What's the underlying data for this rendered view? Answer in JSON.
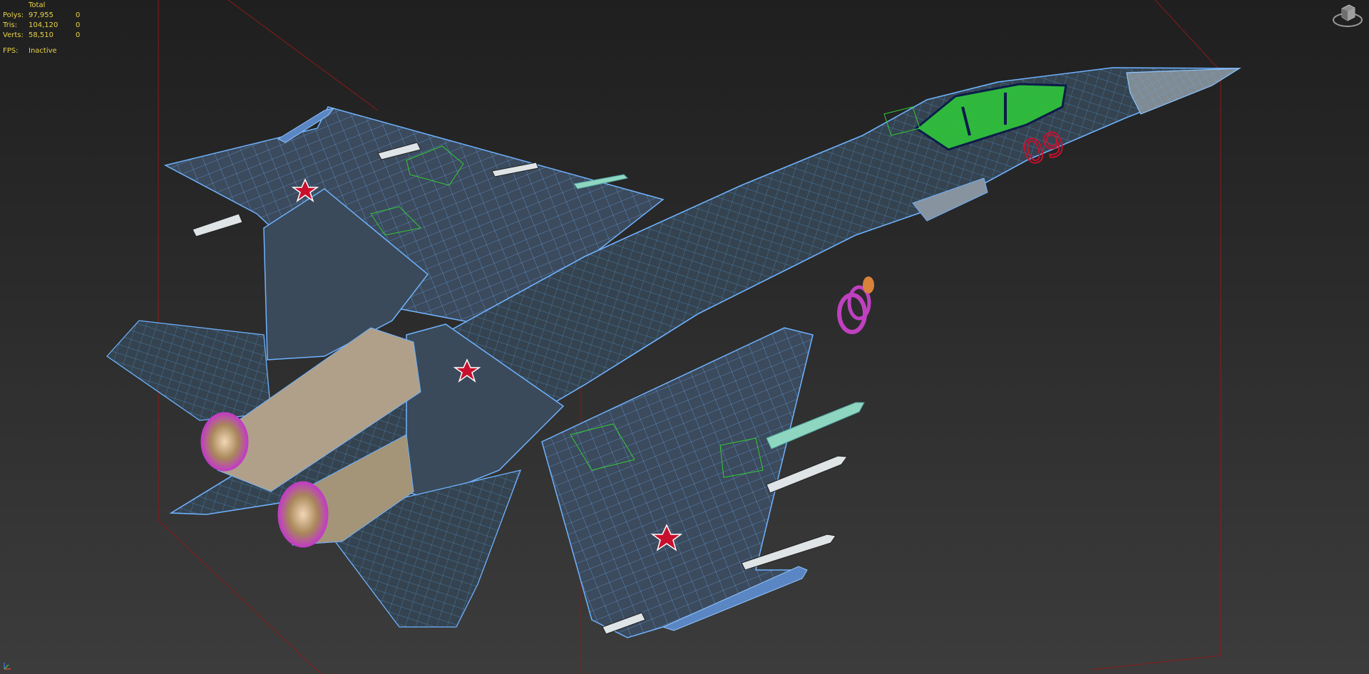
{
  "viewport": {
    "stats": {
      "header": "Total",
      "rows": [
        {
          "label": "Polys:",
          "total": "97,955",
          "selected": "0"
        },
        {
          "label": "Tris:",
          "total": "104,120",
          "selected": "0"
        },
        {
          "label": "Verts:",
          "total": "58,510",
          "selected": "0"
        }
      ],
      "fps_label": "FPS:",
      "fps_value": "Inactive"
    },
    "model": {
      "tail_number": "09"
    },
    "colors": {
      "stats_text": "#e8d34a",
      "wireframe": "#6fb2ff",
      "bounding_box": "#8a1a1a",
      "helper_green": "#33cc33",
      "insignia_red": "#c8102e",
      "nozzle_magenta": "#c040c0"
    },
    "icons": [
      "viewcube-icon",
      "axis-tripod-icon"
    ]
  }
}
